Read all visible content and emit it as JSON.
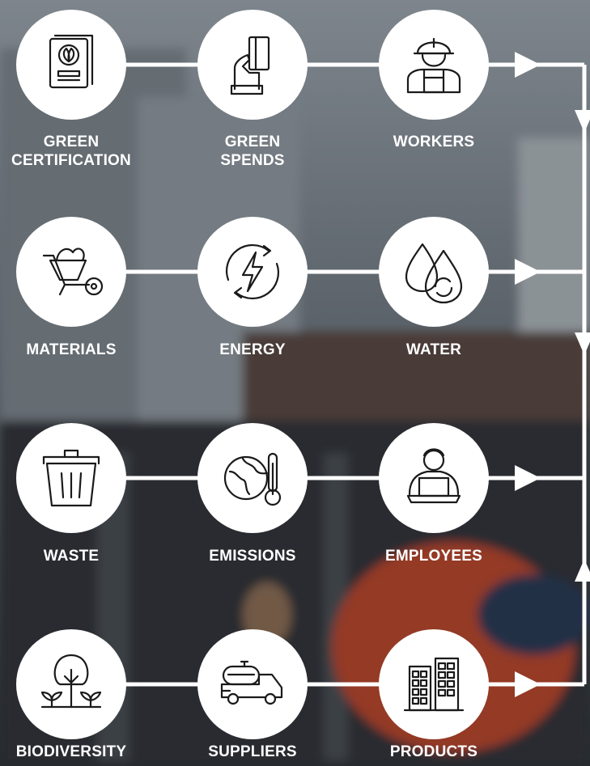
{
  "colors": {
    "circle_fill": "#ffffff",
    "icon_stroke": "#1a1a1a",
    "connector": "#ffffff",
    "label_text": "#ffffff"
  },
  "rows": [
    {
      "nodes": [
        {
          "icon": "green-certificate-icon",
          "label_lines": [
            "GREEN",
            "CERTIFICATION"
          ]
        },
        {
          "icon": "card-payment-icon",
          "label_lines": [
            "GREEN",
            "SPENDS"
          ]
        },
        {
          "icon": "construction-worker-icon",
          "label_lines": [
            "WORKERS"
          ]
        }
      ]
    },
    {
      "nodes": [
        {
          "icon": "wheelbarrow-icon",
          "label_lines": [
            "MATERIALS"
          ]
        },
        {
          "icon": "energy-bolt-icon",
          "label_lines": [
            "ENERGY"
          ]
        },
        {
          "icon": "water-drops-icon",
          "label_lines": [
            "WATER"
          ]
        }
      ]
    },
    {
      "nodes": [
        {
          "icon": "trash-bin-icon",
          "label_lines": [
            "WASTE"
          ]
        },
        {
          "icon": "globe-thermometer-icon",
          "label_lines": [
            "EMISSIONS"
          ]
        },
        {
          "icon": "employee-laptop-icon",
          "label_lines": [
            "EMPLOYEES"
          ]
        }
      ]
    },
    {
      "nodes": [
        {
          "icon": "tree-sprouts-icon",
          "label_lines": [
            "BIODIVERSITY"
          ]
        },
        {
          "icon": "tanker-truck-icon",
          "label_lines": [
            "SUPPLIERS"
          ]
        },
        {
          "icon": "buildings-icon",
          "label_lines": [
            "PRODUCTS"
          ]
        }
      ]
    }
  ]
}
